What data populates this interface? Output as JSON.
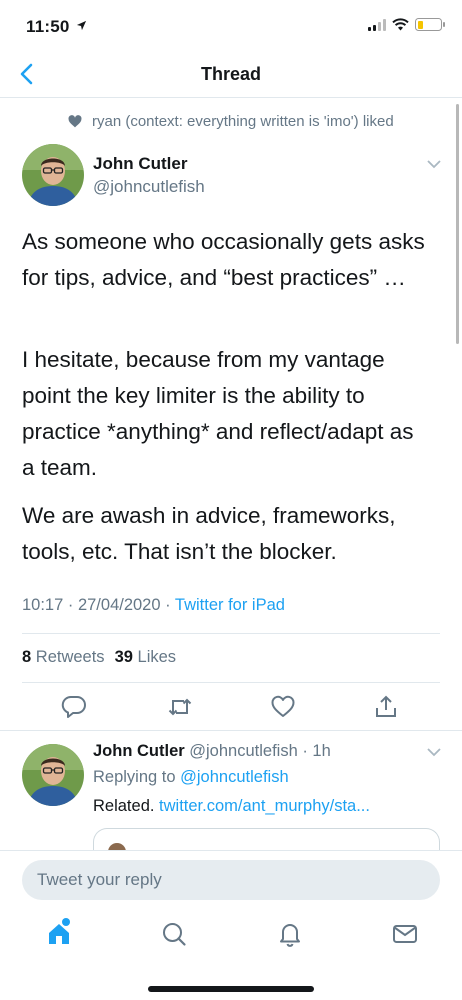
{
  "status_bar": {
    "time": "11:50"
  },
  "header": {
    "title": "Thread"
  },
  "social_context": {
    "text": "ryan (context: everything written is 'imo') liked"
  },
  "tweet": {
    "author_name": "John Cutler",
    "author_handle": "@johncutlefish",
    "paragraphs": [
      "As someone who occasionally gets asks for tips, advice, and “best practices” …",
      "I hesitate, because from my vantage point the key limiter is the ability to practice *anything* and reflect/adapt as a team.",
      "We are awash in advice, frameworks, tools, etc. That isn’t the blocker."
    ],
    "timestamp": "10:17 · 27/04/2020 · ",
    "source": "Twitter for iPad",
    "retweets_count": "8",
    "retweets_label": "Retweets",
    "likes_count": "39",
    "likes_label": "Likes"
  },
  "reply": {
    "author_name": "John Cutler",
    "author_handle": "@johncutlefish",
    "time": "· 1h",
    "replying_prefix": "Replying to ",
    "replying_to": "@johncutlefish",
    "text": "Related. ",
    "link": "twitter.com/ant_murphy/sta..."
  },
  "compose": {
    "placeholder": "Tweet your reply"
  },
  "icons": {
    "back": "chevron-left-icon",
    "heart_small": "heart-icon",
    "caret": "chevron-down-icon",
    "reply": "reply-icon",
    "retweet": "retweet-icon",
    "like": "heart-outline-icon",
    "share": "share-icon",
    "home": "home-icon",
    "search": "search-icon",
    "notifications": "bell-icon",
    "messages": "envelope-icon"
  },
  "colors": {
    "accent": "#1da1f2",
    "secondary_text": "#657786",
    "divider": "#e1e8ed",
    "battery": "#f5c400"
  }
}
